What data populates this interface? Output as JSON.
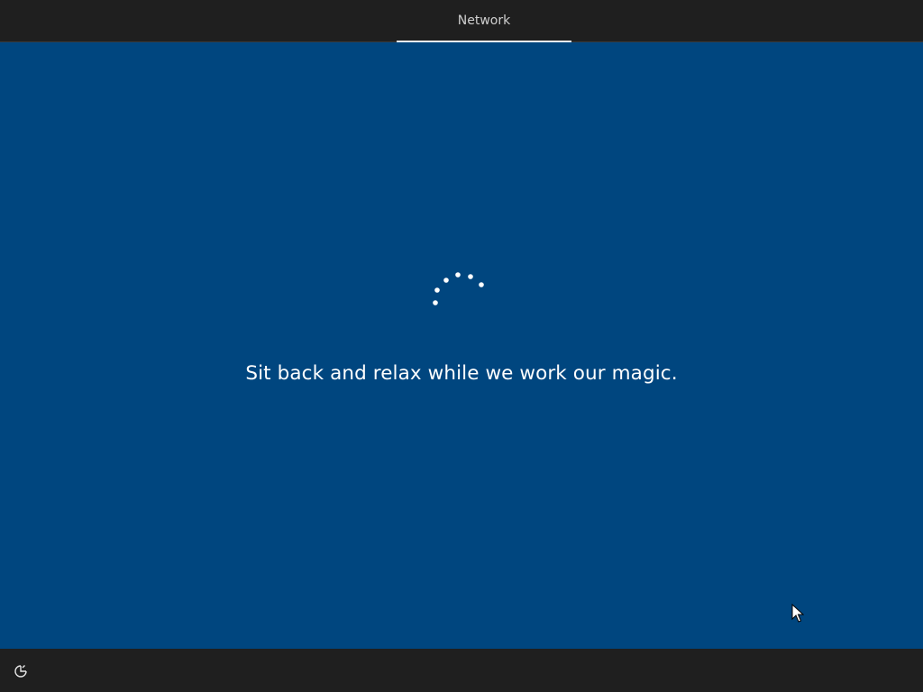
{
  "header": {
    "active_step": "Network"
  },
  "main": {
    "status_message": "Sit back and relax while we work our magic."
  },
  "spinner": {
    "icon": "loading-dots-spinner",
    "color": "#ffffff"
  },
  "footer": {
    "ease_of_access_icon": "ease-of-access-icon"
  },
  "colors": {
    "background": "#00467f",
    "bars": "#1f1f1f",
    "text": "#ffffff"
  }
}
